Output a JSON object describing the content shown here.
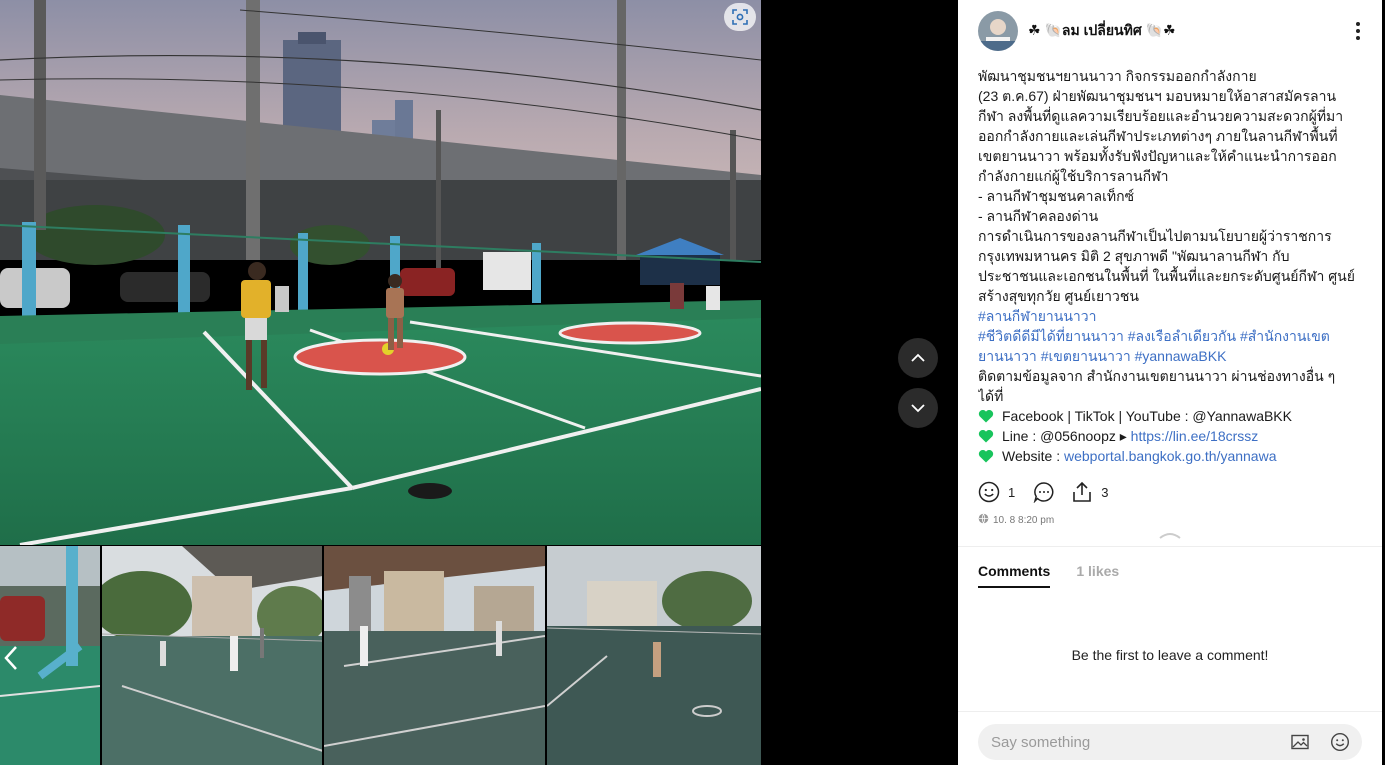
{
  "post": {
    "author": "☘ 🐚ลม เปลี่ยนทิศ 🐚☘",
    "caption_lines": [
      {
        "parts": [
          {
            "t": "พัฒนาชุมชนฯยานนาวา กิจกรรมออกกำลังกาย"
          }
        ]
      },
      {
        "parts": [
          {
            "t": " (23 ต.ค.67)  ฝ่ายพัฒนาชุมชนฯ มอบหมายให้อาสาสมัครลาน"
          }
        ]
      },
      {
        "parts": [
          {
            "t": "กีฬา ลงพื้นที่ดูแลความเรียบร้อยและอำนวยความสะดวกผู้ที่มา"
          }
        ]
      },
      {
        "parts": [
          {
            "t": "ออกกำลังกายและเล่นกีฬาประเภทต่างๆ ภายในลานกีฬาพื้นที่"
          }
        ]
      },
      {
        "parts": [
          {
            "t": "เขตยานนาวา พร้อมทั้งรับฟังปัญหาและให้คำแนะนำการออก"
          }
        ]
      },
      {
        "parts": [
          {
            "t": "กำลังกายแก่ผู้ใช้บริการลานกีฬา"
          }
        ]
      },
      {
        "parts": [
          {
            "t": "- ลานกีฬาชุมชนคาลเท็กซ์"
          }
        ]
      },
      {
        "parts": [
          {
            "t": "- ลานกีฬาคลองด่าน"
          }
        ]
      },
      {
        "parts": [
          {
            "t": "   การดำเนินการของลานกีฬาเป็นไปตามนโยบายผู้ว่าราชการ"
          }
        ]
      },
      {
        "parts": [
          {
            "t": "กรุงเทพมหานคร  มิติ 2 สุขภาพดี  \"พัฒนาลานกีฬา กับ"
          }
        ]
      },
      {
        "parts": [
          {
            "t": "ประชาชนและเอกชนในพื้นที่ ในพื้นที่และยกระดับศูนย์กีฬา ศูนย์"
          }
        ]
      },
      {
        "parts": [
          {
            "t": "สร้างสุขทุกวัย ศูนย์เยาวชน"
          }
        ]
      },
      {
        "parts": [
          {
            "t": "#ลานกีฬายานนาวา",
            "k": "tag"
          }
        ]
      },
      {
        "parts": [
          {
            "t": "#ชีวิตดีดีมีได้ที่ยานนาวา",
            "k": "tag"
          },
          {
            "t": " "
          },
          {
            "t": "#ลงเรือลำเดียวกัน",
            "k": "tag"
          },
          {
            "t": " "
          },
          {
            "t": "#สำนักงานเขต",
            "k": "tag"
          }
        ]
      },
      {
        "parts": [
          {
            "t": "ยานนาวา",
            "k": "tag"
          },
          {
            "t": " "
          },
          {
            "t": "#เขตยานนาวา",
            "k": "tag"
          },
          {
            "t": " "
          },
          {
            "t": "#yannawaBKK",
            "k": "tag"
          }
        ]
      },
      {
        "parts": [
          {
            "t": "ติดตามข้อมูลจาก สำนักงานเขตยานนาวา ผ่านช่องทางอื่น ๆ"
          }
        ]
      },
      {
        "parts": [
          {
            "t": "ได้ที่"
          }
        ]
      },
      {
        "parts": [
          {
            "k": "heart"
          },
          {
            "t": "Facebook | TikTok | YouTube : @YannawaBKK"
          }
        ]
      },
      {
        "parts": [
          {
            "k": "heart"
          },
          {
            "t": "Line : @056noopz ▸ "
          },
          {
            "t": "https://lin.ee/18crssz",
            "k": "link"
          }
        ]
      },
      {
        "parts": [
          {
            "k": "heart"
          },
          {
            "t": "Website : "
          },
          {
            "t": "webportal.bangkok.go.th/yannawa",
            "k": "link"
          }
        ]
      }
    ],
    "reaction_count": "1",
    "share_count": "3",
    "timestamp": "10. 8 8:20 pm"
  },
  "tabs": {
    "comments": "Comments",
    "likes": "1 likes"
  },
  "empty_message": "Be the first to leave a comment!",
  "comment_input": {
    "placeholder": "Say something"
  },
  "icons": {
    "zoom": "scan-zoom-icon",
    "prev": "chevron-left-icon",
    "up": "chevron-up-icon",
    "down": "chevron-down-icon",
    "more": "more-vertical-icon",
    "smile": "smile-icon",
    "comment": "comment-icon",
    "share": "share-icon",
    "globe": "globe-icon",
    "image": "image-icon",
    "emoji": "emoji-icon",
    "heart": "green-heart-icon"
  },
  "colors": {
    "hashtag": "#3d6fc4",
    "heart": "#18c45c",
    "court_green": "#2f8f5e"
  }
}
